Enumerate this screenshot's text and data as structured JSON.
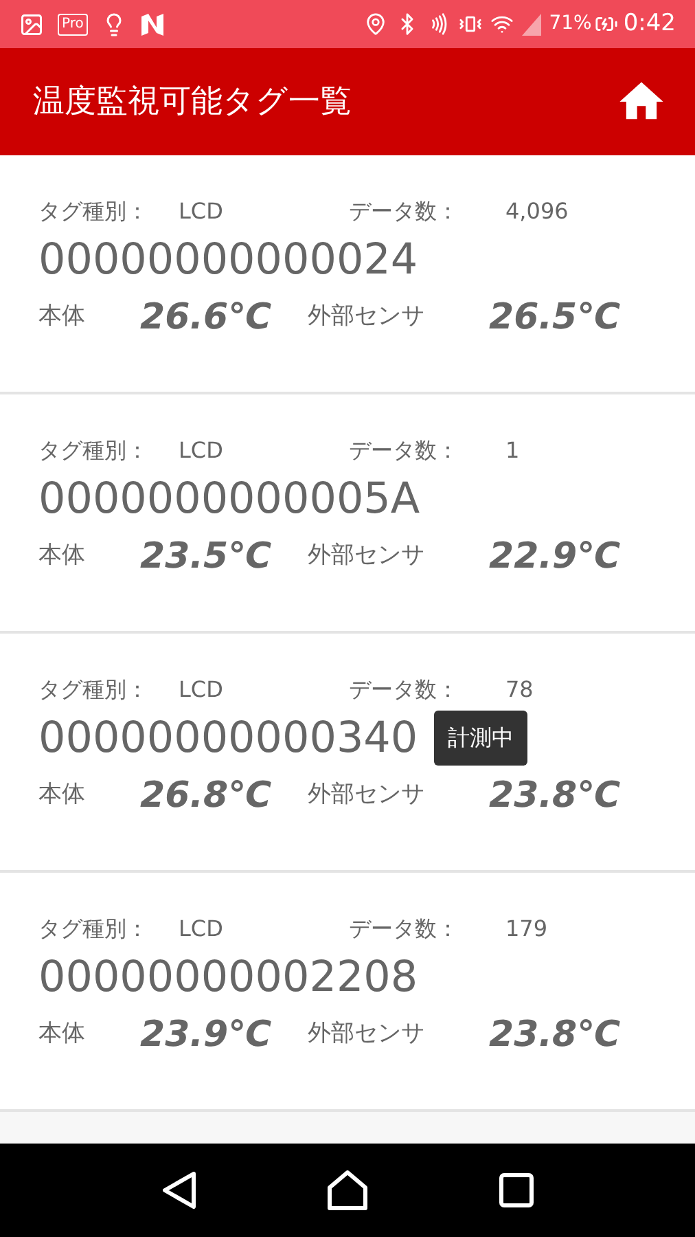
{
  "status_bar": {
    "app_badge": "Pro",
    "battery": "71%",
    "time": "0:42"
  },
  "app_bar": {
    "title": "温度監視可能タグ一覧"
  },
  "tags": [
    {
      "type_label": "タグ種別：",
      "type": "LCD",
      "count_label": "データ数：",
      "count": "4,096",
      "id": "00000000000024",
      "body_label": "本体",
      "body_temp": "26.6℃",
      "external_label": "外部センサ",
      "external_temp": "26.5℃",
      "measuring": false
    },
    {
      "type_label": "タグ種別：",
      "type": "LCD",
      "count_label": "データ数：",
      "count": "1",
      "id": "0000000000005A",
      "body_label": "本体",
      "body_temp": "23.5℃",
      "external_label": "外部センサ",
      "external_temp": "22.9℃",
      "measuring": false
    },
    {
      "type_label": "タグ種別：",
      "type": "LCD",
      "count_label": "データ数：",
      "count": "78",
      "id": "00000000000340",
      "body_label": "本体",
      "body_temp": "26.8℃",
      "external_label": "外部センサ",
      "external_temp": "23.8℃",
      "measuring": true,
      "measuring_label": "計測中"
    },
    {
      "type_label": "タグ種別：",
      "type": "LCD",
      "count_label": "データ数：",
      "count": "179",
      "id": "00000000002208",
      "body_label": "本体",
      "body_temp": "23.9℃",
      "external_label": "外部センサ",
      "external_temp": "23.8℃",
      "measuring": false
    }
  ]
}
